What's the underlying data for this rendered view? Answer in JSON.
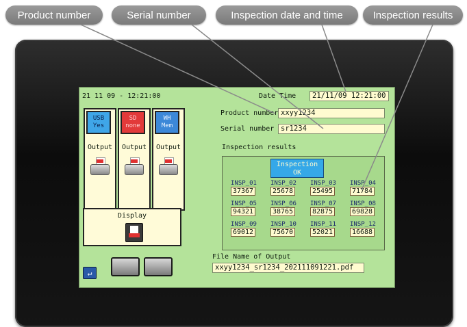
{
  "callouts": {
    "product": "Product number",
    "serial": "Serial number",
    "datetime": "Inspection date and time",
    "results": "Inspection results"
  },
  "screen": {
    "clock": "21 11 09 - 12:21:00",
    "date_time_label": "Date  Time",
    "date_time_value": "21/11/09 12:21:00",
    "product_label": "Product number",
    "product_value": "xxyy1234",
    "serial_label": "Serial number",
    "serial_value": "sr1234",
    "results_label": "Inspection results",
    "status_line1": "Inspection",
    "status_line2": "OK",
    "output_label": "Output",
    "display_label": "Display",
    "file_label": "File Name of Output",
    "file_value": "xxyy1234_sr1234_202111091221.pdf"
  },
  "storage_tabs": [
    {
      "line1": "USB",
      "line2": "Yes"
    },
    {
      "line1": "SD",
      "line2": "none"
    },
    {
      "line1": "WH",
      "line2": "Mem"
    }
  ],
  "inspections": [
    {
      "name": "INSP_01",
      "value": "37367"
    },
    {
      "name": "INSP_02",
      "value": "25678"
    },
    {
      "name": "INSP_03",
      "value": "25495"
    },
    {
      "name": "INSP_04",
      "value": "71784"
    },
    {
      "name": "INSP_05",
      "value": "94321"
    },
    {
      "name": "INSP_06",
      "value": "38765"
    },
    {
      "name": "INSP_07",
      "value": "82875"
    },
    {
      "name": "INSP_08",
      "value": "69828"
    },
    {
      "name": "INSP_09",
      "value": "69012"
    },
    {
      "name": "INSP_10",
      "value": "75670"
    },
    {
      "name": "INSP_11",
      "value": "52021"
    },
    {
      "name": "INSP_12",
      "value": "16688"
    }
  ],
  "colors": {
    "screen_bg": "#b4e39a",
    "field_bg": "#fffbd0",
    "ok_button": "#35a8e8",
    "usb_tab": "#3fa6e8",
    "sd_tab": "#e23a3a",
    "wh_tab": "#3c88d8"
  }
}
